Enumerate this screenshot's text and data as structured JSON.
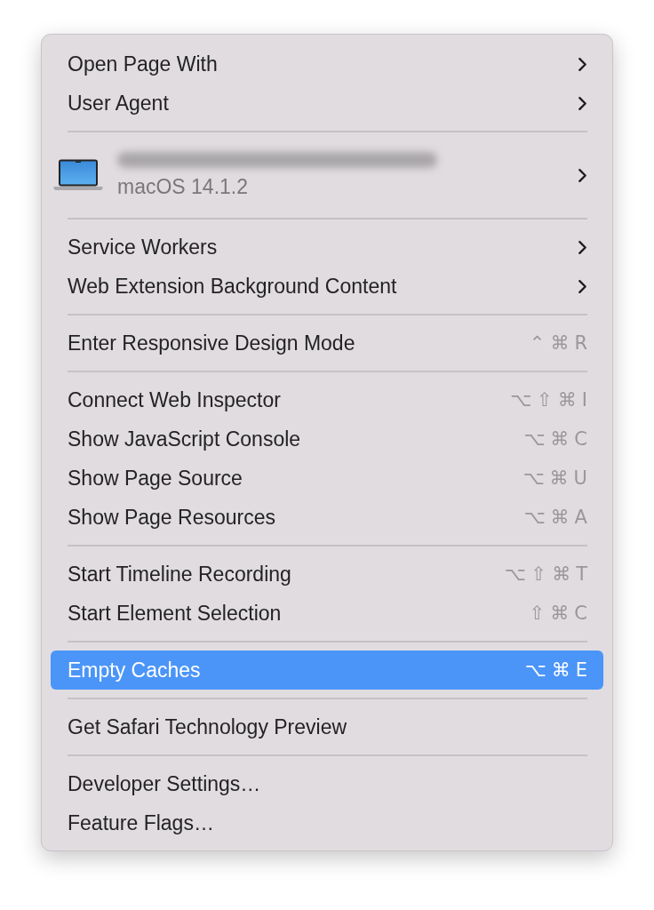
{
  "menu": {
    "sections": [
      {
        "items": [
          {
            "kind": "submenu",
            "label": "Open Page With",
            "selected": false
          },
          {
            "kind": "submenu",
            "label": "User Agent",
            "selected": false
          }
        ]
      },
      {
        "items": [
          {
            "kind": "device",
            "subtitle": "macOS 14.1.2",
            "selected": false
          }
        ]
      },
      {
        "items": [
          {
            "kind": "submenu",
            "label": "Service Workers",
            "selected": false
          },
          {
            "kind": "submenu",
            "label": "Web Extension Background Content",
            "selected": false
          }
        ]
      },
      {
        "items": [
          {
            "kind": "shortcut",
            "label": "Enter Responsive Design Mode",
            "shortcut": "⌃⌘R",
            "selected": false
          }
        ]
      },
      {
        "items": [
          {
            "kind": "shortcut",
            "label": "Connect Web Inspector",
            "shortcut": "⌥⇧⌘I",
            "selected": false
          },
          {
            "kind": "shortcut",
            "label": "Show JavaScript Console",
            "shortcut": "⌥⌘C",
            "selected": false
          },
          {
            "kind": "shortcut",
            "label": "Show Page Source",
            "shortcut": "⌥⌘U",
            "selected": false
          },
          {
            "kind": "shortcut",
            "label": "Show Page Resources",
            "shortcut": "⌥⌘A",
            "selected": false
          }
        ]
      },
      {
        "items": [
          {
            "kind": "shortcut",
            "label": "Start Timeline Recording",
            "shortcut": "⌥⇧⌘T",
            "selected": false
          },
          {
            "kind": "shortcut",
            "label": "Start Element Selection",
            "shortcut": "⇧⌘C",
            "selected": false
          }
        ]
      },
      {
        "items": [
          {
            "kind": "shortcut",
            "label": "Empty Caches",
            "shortcut": "⌥⌘E",
            "selected": true
          }
        ]
      },
      {
        "items": [
          {
            "kind": "plain",
            "label": "Get Safari Technology Preview",
            "selected": false
          }
        ]
      },
      {
        "items": [
          {
            "kind": "plain",
            "label": "Developer Settings…",
            "selected": false
          },
          {
            "kind": "plain",
            "label": "Feature Flags…",
            "selected": false
          }
        ]
      }
    ]
  }
}
